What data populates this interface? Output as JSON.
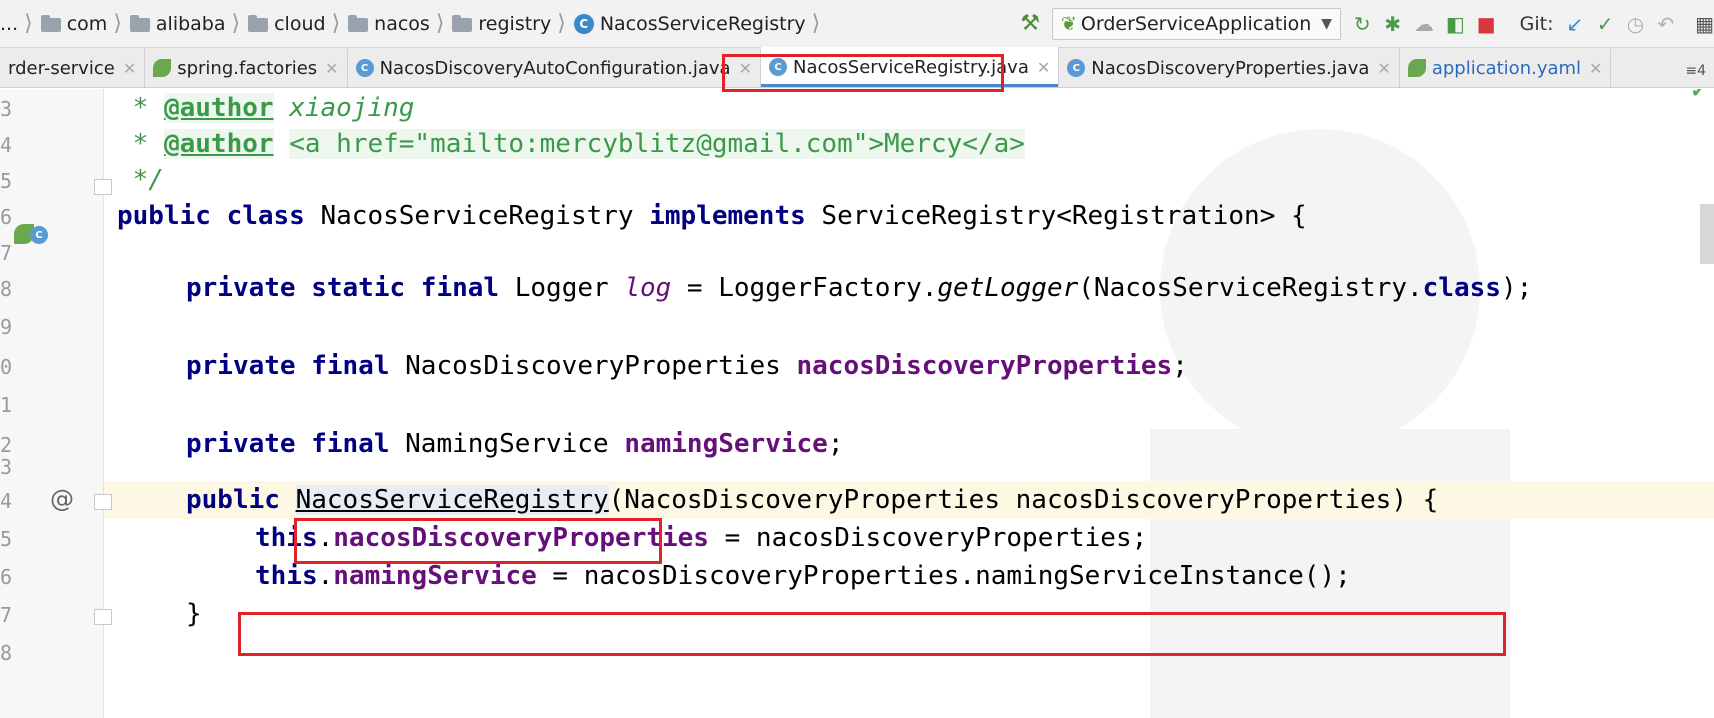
{
  "breadcrumb": {
    "lead": "...",
    "items": [
      "com",
      "alibaba",
      "cloud",
      "nacos",
      "registry"
    ],
    "class_name": "NacosServiceRegistry"
  },
  "toolbar": {
    "run_config": "OrderServiceApplication",
    "git_label": "Git:"
  },
  "tabs": [
    {
      "label": "rder-service",
      "icon": "none"
    },
    {
      "label": "spring.factories",
      "icon": "spring-icon"
    },
    {
      "label": "NacosDiscoveryAutoConfiguration.java",
      "icon": "class-icon"
    },
    {
      "label": "NacosServiceRegistry.java",
      "icon": "class-icon",
      "active": true
    },
    {
      "label": "NacosDiscoveryProperties.java",
      "icon": "class-icon"
    },
    {
      "label": "application.yaml",
      "icon": "spring-icon"
    }
  ],
  "tabs_more": "≡4",
  "gutter": {
    "line_numbers": [
      "3",
      "4",
      "5",
      "6",
      "7",
      "8",
      "9",
      "0",
      "1",
      "2",
      "3",
      "4",
      "5",
      "6",
      "7",
      "8"
    ],
    "at_marker": "@"
  },
  "code": {
    "l1": {
      "a": " * ",
      "b": "@author",
      "c": " xiaojing"
    },
    "l2": {
      "a": " * ",
      "b": "@author",
      "c": " ",
      "d": "<a href=\"mailto:mercyblitz@gmail.com\">Mercy</a>"
    },
    "l3": {
      "a": " */"
    },
    "l4": {
      "a": "public class",
      "b": " NacosServiceRegistry ",
      "c": "implements",
      "d": " ServiceRegistry<Registration> {"
    },
    "l5": {
      "a": "private static final",
      "b": " Logger ",
      "c": "log",
      "d": " = LoggerFactory.",
      "e": "getLogger",
      "f": "(NacosServiceRegistry.",
      "g": "class",
      "h": ");"
    },
    "l6": {
      "a": "private final",
      "b": " NacosDiscoveryProperties ",
      "c": "nacosDiscoveryProperties",
      "d": ";"
    },
    "l7": {
      "a": "private final",
      "b": " NamingService ",
      "c": "namingService",
      "d": ";"
    },
    "l8": {
      "a": "public",
      "b": " ",
      "c": "NacosServiceRegistry",
      "d": "(NacosDiscoveryProperties nacosDiscoveryProperties) {"
    },
    "l9": {
      "a": "this",
      "b": ".",
      "c": "nacosDiscoveryProperties",
      "d": " = nacosDiscoveryProperties;"
    },
    "l10": {
      "a": "this",
      "b": ".",
      "c": "namingService",
      "d": " = nacosDiscoveryProperties.namingServiceInstance();"
    },
    "l11": {
      "a": "}"
    }
  },
  "colors": {
    "keyword": "#000080",
    "field": "#660e7a",
    "comment": "#3a9a4a",
    "highlight_box": "#e0222a",
    "current_line": "#fdf8e3"
  }
}
